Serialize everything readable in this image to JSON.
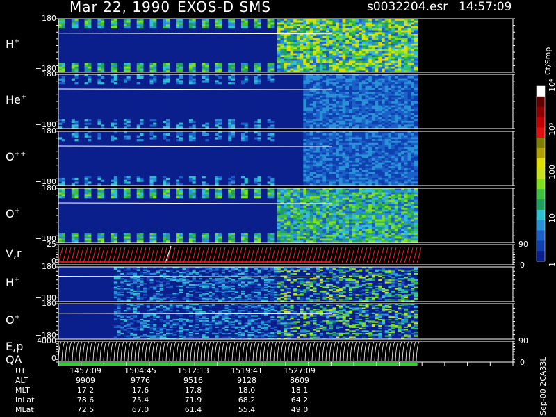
{
  "header": {
    "date": "Mar 22, 1990",
    "instrument": "EXOS-D SMS",
    "file": "s0032204.esr",
    "time": "14:57:09"
  },
  "colors": {
    "background": "#000000",
    "spectrogram_low": "#0a1e8c",
    "qa_bar": "#33cc33",
    "velocity_trace": "#ff2020"
  },
  "panels": [
    {
      "label": "H",
      "charge": "+",
      "ymax": "180",
      "ymin": "−180"
    },
    {
      "label": "He",
      "charge": "+",
      "ymax": "180",
      "ymin": "−180"
    },
    {
      "label": "O",
      "charge": "++",
      "ymax": "180",
      "ymin": "−180"
    },
    {
      "label": "O",
      "charge": "+",
      "ymax": "180",
      "ymin": "−180"
    },
    {
      "label": "V,r",
      "charge": "",
      "ymax": "25",
      "ymin": "0",
      "rmax": "90",
      "rmin": "0"
    },
    {
      "label": "H",
      "charge": "+",
      "ymax": "180",
      "ymin": "−180"
    },
    {
      "label": "O",
      "charge": "+",
      "ymax": "180",
      "ymin": "−180"
    },
    {
      "label": "E,p",
      "label2": "QA",
      "charge": "",
      "ymax": "4000",
      "ymin": "0",
      "rmax": "90",
      "rmin": "0"
    }
  ],
  "colorbar": {
    "units": "Ct/Smp",
    "ticks": [
      "1",
      "10",
      "100",
      "10³",
      "10⁴"
    ],
    "tick_values": [
      1,
      10,
      100,
      1000,
      10000
    ],
    "colors": [
      "#0a1e8c",
      "#1040b0",
      "#1a60c8",
      "#2a90d8",
      "#30c0d0",
      "#20a060",
      "#40c040",
      "#80e020",
      "#c8e020",
      "#e0e000",
      "#b0a000",
      "#808000",
      "#e01010",
      "#c00000",
      "#900000",
      "#600000",
      "#ffffff"
    ]
  },
  "chart_data": {
    "type": "heatmap",
    "title": "Mar 22, 1990   EXOS-D SMS",
    "x_axis": "UT",
    "data_end_fraction": 0.79,
    "ephemeris": {
      "labels": [
        "UT",
        "ALT",
        "MLT",
        "InLat",
        "MLat"
      ],
      "columns": [
        {
          "UT": "1457:09",
          "ALT": "9909",
          "MLT": "17.2",
          "InLat": "78.6",
          "MLat": "72.5"
        },
        {
          "UT": "1504:45",
          "ALT": "9776",
          "MLT": "17.6",
          "InLat": "75.4",
          "MLat": "67.0"
        },
        {
          "UT": "1512:13",
          "ALT": "9516",
          "MLT": "17.8",
          "InLat": "71.9",
          "MLat": "61.4"
        },
        {
          "UT": "1519:41",
          "ALT": "9128",
          "MLT": "18.0",
          "InLat": "68.2",
          "MLat": "55.4"
        },
        {
          "UT": "1527:09",
          "ALT": "8609",
          "MLT": "18.1",
          "InLat": "64.2",
          "MLat": "49.0"
        }
      ]
    }
  },
  "side_label": "Sep-00 2CA33L"
}
